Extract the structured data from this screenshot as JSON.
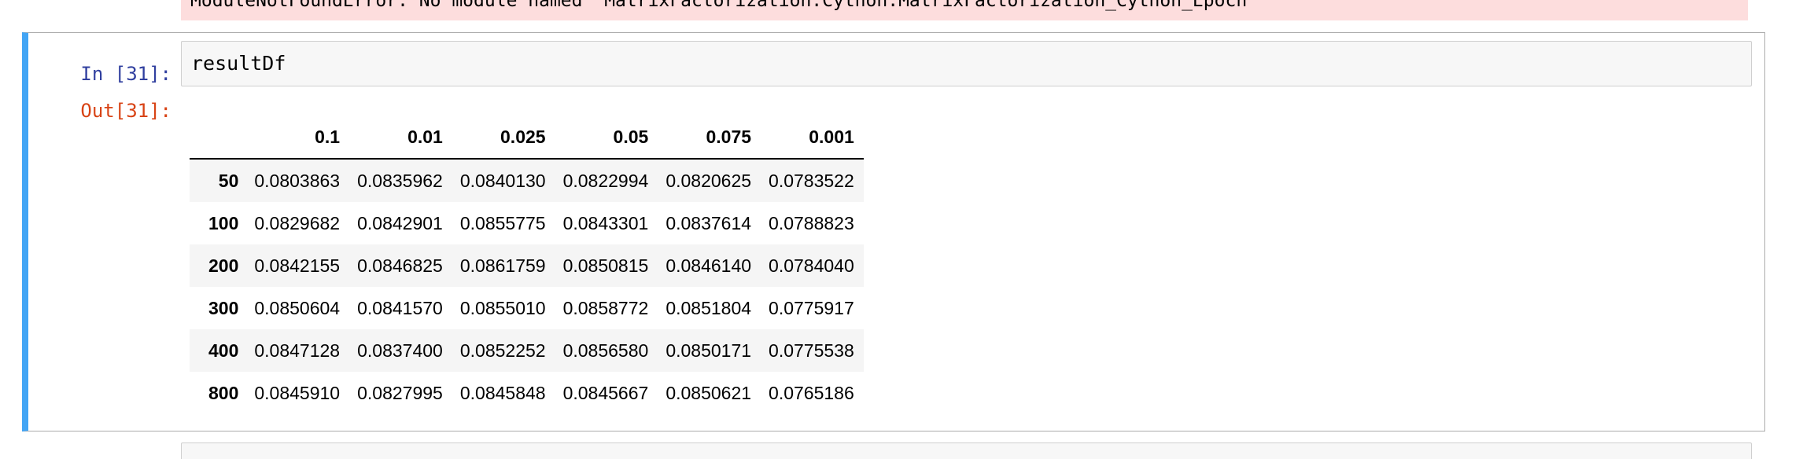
{
  "previous_output": {
    "error_text": "ModuleNotFoundError: No module named 'MatrixFactorization.Cython.MatrixFactorization_Cython_Epoch'"
  },
  "cell": {
    "in_prompt": "In [31]:",
    "code": "resultDf",
    "out_prompt": "Out[31]:"
  },
  "dataframe": {
    "columns": [
      "",
      "0.1",
      "0.01",
      "0.025",
      "0.05",
      "0.075",
      "0.001"
    ],
    "rows": [
      {
        "index": "50",
        "values": [
          "0.0803863",
          "0.0835962",
          "0.0840130",
          "0.0822994",
          "0.0820625",
          "0.0783522"
        ]
      },
      {
        "index": "100",
        "values": [
          "0.0829682",
          "0.0842901",
          "0.0855775",
          "0.0843301",
          "0.0837614",
          "0.0788823"
        ]
      },
      {
        "index": "200",
        "values": [
          "0.0842155",
          "0.0846825",
          "0.0861759",
          "0.0850815",
          "0.0846140",
          "0.0784040"
        ]
      },
      {
        "index": "300",
        "values": [
          "0.0850604",
          "0.0841570",
          "0.0855010",
          "0.0858772",
          "0.0851804",
          "0.0775917"
        ]
      },
      {
        "index": "400",
        "values": [
          "0.0847128",
          "0.0837400",
          "0.0852252",
          "0.0856580",
          "0.0850171",
          "0.0775538"
        ]
      },
      {
        "index": "800",
        "values": [
          "0.0845910",
          "0.0827995",
          "0.0845848",
          "0.0845667",
          "0.0850621",
          "0.0765186"
        ]
      }
    ]
  },
  "colors": {
    "selected_cell_border": "#42a5f5",
    "in_prompt": "#303f9f",
    "out_prompt": "#d84315",
    "error_background": "#fddddd"
  }
}
